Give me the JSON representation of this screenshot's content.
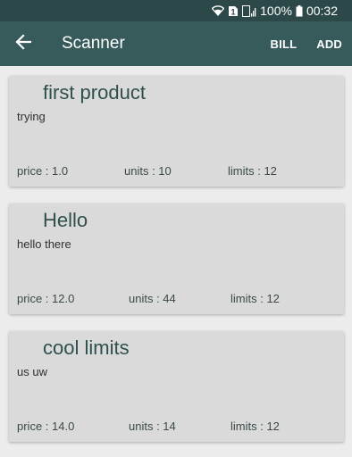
{
  "status_bar": {
    "battery_percent": "100%",
    "time": "00:32",
    "sim_badge": "1",
    "icons": [
      "wifi-icon",
      "sim-icon",
      "signal-icon",
      "battery-icon"
    ]
  },
  "app_bar": {
    "title": "Scanner",
    "back_icon": "arrow-back-icon",
    "actions": [
      {
        "label": "BILL"
      },
      {
        "label": "ADD"
      }
    ]
  },
  "colors": {
    "status_bar": "#2c4848",
    "app_bar": "#375a5a",
    "background": "#ececec",
    "card": "#dadada",
    "title_text": "#2f4f4f"
  },
  "products": [
    {
      "name": "first product",
      "description": "trying",
      "price": "price : 1.0",
      "units": "units : 10",
      "limits": "limits : 12"
    },
    {
      "name": "Hello",
      "description": "hello there",
      "price": "price : 12.0",
      "units": "units : 44",
      "limits": "limits : 12"
    },
    {
      "name": "cool limits",
      "description": "us uw",
      "price": "price : 14.0",
      "units": "units : 14",
      "limits": "limits : 12"
    }
  ]
}
